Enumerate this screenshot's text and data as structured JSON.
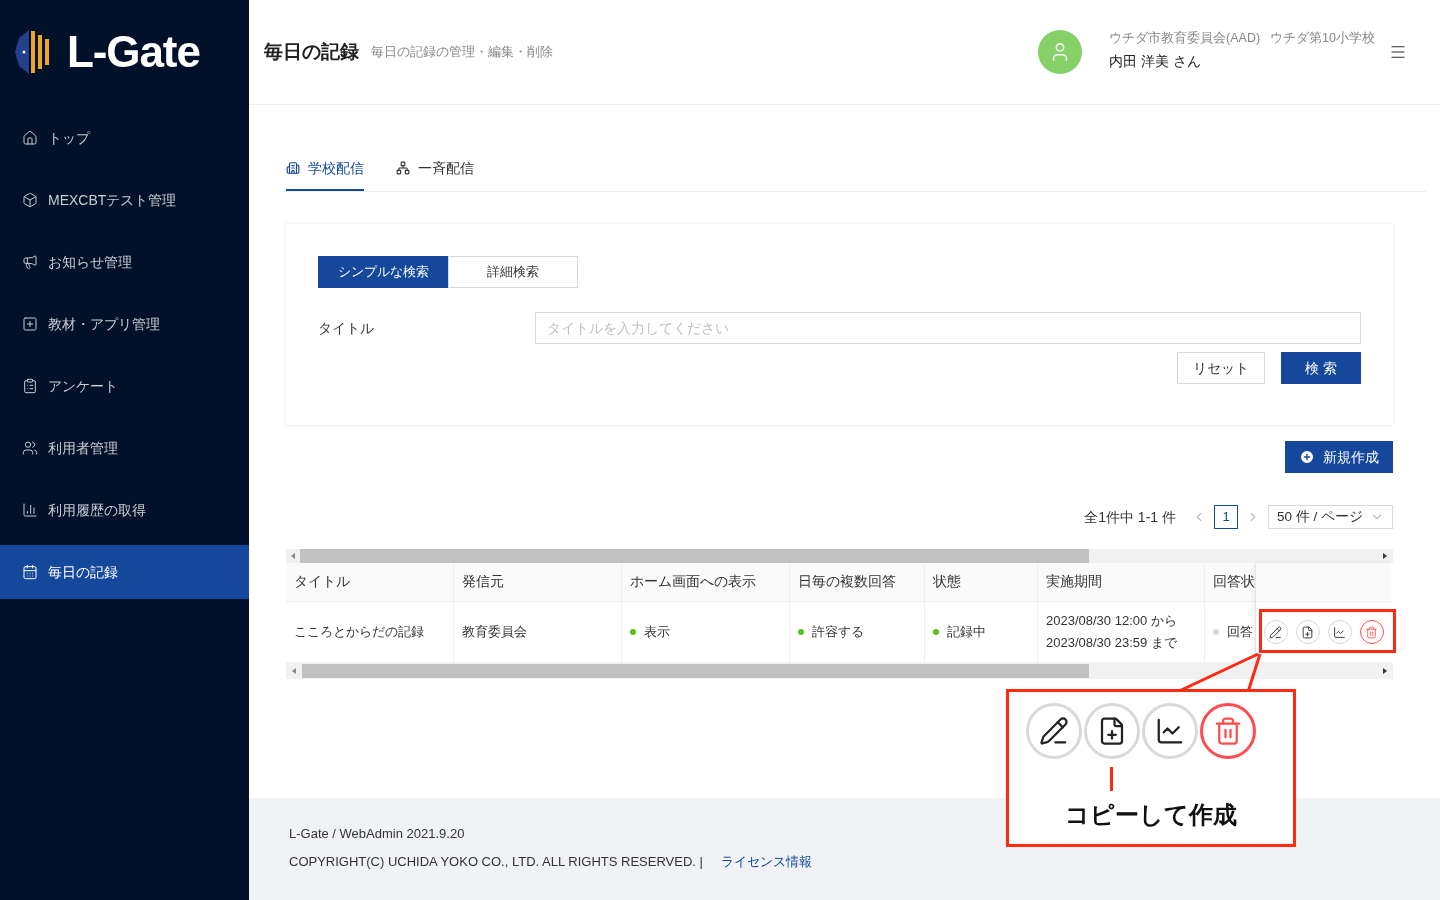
{
  "sidebar": {
    "logo": "L-Gate",
    "items": [
      {
        "label": "トップ",
        "selected": false
      },
      {
        "label": "MEXCBTテスト管理",
        "selected": false
      },
      {
        "label": "お知らせ管理",
        "selected": false
      },
      {
        "label": "教材・アプリ管理",
        "selected": false
      },
      {
        "label": "アンケート",
        "selected": false
      },
      {
        "label": "利用者管理",
        "selected": false
      },
      {
        "label": "利用履歴の取得",
        "selected": false
      },
      {
        "label": "毎日の記録",
        "selected": true
      }
    ]
  },
  "header": {
    "title": "毎日の記録",
    "subtitle": "毎日の記録の管理・編集・削除",
    "org": "ウチダ市教育委員会(AAD)",
    "school": "ウチダ第10小学校",
    "user": "内田 洋美 さん"
  },
  "tabs": [
    {
      "label": "学校配信",
      "selected": true
    },
    {
      "label": "一斉配信",
      "selected": false
    }
  ],
  "search": {
    "modes": [
      {
        "label": "シンプルな検索",
        "selected": true
      },
      {
        "label": "詳細検索",
        "selected": false
      }
    ],
    "field_label": "タイトル",
    "placeholder": "タイトルを入力してください",
    "reset": "リセット",
    "submit": "検 索"
  },
  "create_button": "新規作成",
  "pagination": {
    "summary": "全1件中 1-1 件",
    "pages": [
      {
        "label": "1",
        "selected": true
      }
    ],
    "page_size": "50 件 / ページ"
  },
  "table": {
    "columns": [
      "タイトル",
      "発信元",
      "ホーム画面への表示",
      "日毎の複数回答",
      "状態",
      "実施期間",
      "回答状"
    ],
    "rows": [
      {
        "cells": [
          {
            "lines": [
              "こころとからだの記録"
            ]
          },
          {
            "lines": [
              "教育委員会"
            ]
          },
          {
            "lines": [
              "表示"
            ],
            "color": "#52c41a"
          },
          {
            "lines": [
              "許容する"
            ],
            "color": "#52c41a"
          },
          {
            "lines": [
              "記録中"
            ],
            "color": "#52c41a"
          },
          {
            "lines": [
              "2023/08/30 12:00 から",
              "2023/08/30 23:59 まで"
            ]
          },
          {
            "lines": [
              "回答"
            ],
            "color": "#d9d9d9"
          }
        ],
        "actions": [
          {
            "kind": "edit"
          },
          {
            "kind": "copy"
          },
          {
            "kind": "chart"
          },
          {
            "kind": "delete"
          }
        ]
      }
    ]
  },
  "callout": {
    "label": "コピーして作成",
    "actions": [
      {
        "kind": "edit"
      },
      {
        "kind": "copy"
      },
      {
        "kind": "chart"
      },
      {
        "kind": "delete"
      }
    ]
  },
  "footer": {
    "version": "L-Gate / WebAdmin 2021.9.20",
    "copyright": "COPYRIGHT(C) UCHIDA YOKO CO., LTD. ALL RIGHTS RESERVED. |",
    "link": "ライセンス情報"
  }
}
